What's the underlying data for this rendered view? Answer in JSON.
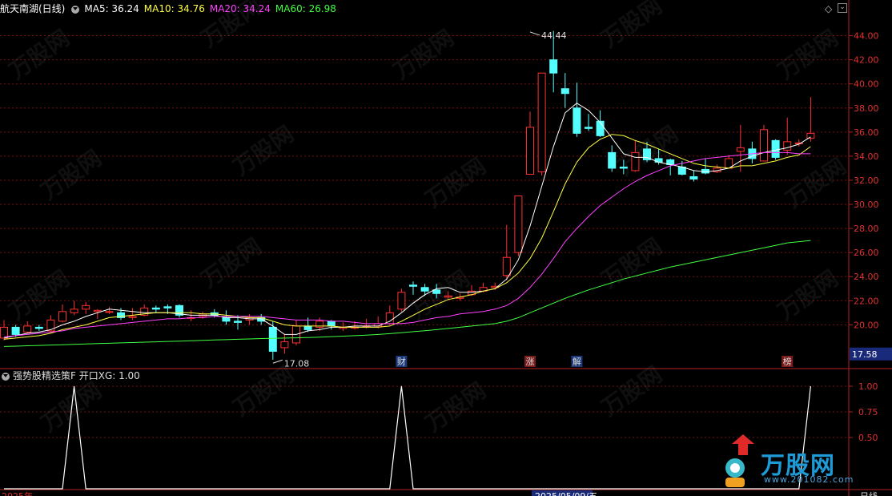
{
  "header": {
    "stock": "航天南湖(日线)",
    "ma": [
      {
        "label": "MA5: 36.24",
        "color": "#ffffff"
      },
      {
        "label": "MA10: 34.76",
        "color": "#ffff40"
      },
      {
        "label": "MA20: 34.24",
        "color": "#ff40ff"
      },
      {
        "label": "MA60: 26.98",
        "color": "#40ff40"
      }
    ]
  },
  "sub_header": {
    "label": "强势股精选策F 开口XG: 1.00"
  },
  "current_price": "17.58",
  "logo": {
    "text": "万股网",
    "url": "www.201082.com"
  },
  "bottom_labels": {
    "left": "2025年",
    "date": "2025/05/09/五",
    "right": "日线"
  },
  "colors": {
    "up": "#ff3030",
    "down": "#54ffff",
    "grid": "#7a1010",
    "ma5": "#ffffff",
    "ma10": "#ffff40",
    "ma20": "#ff40ff",
    "ma60": "#40ff40"
  },
  "chart_data": [
    {
      "type": "candlestick",
      "title": "航天南湖(日线)",
      "ylim": [
        16.5,
        45.5
      ],
      "yticks": [
        20,
        22,
        24,
        26,
        28,
        30,
        32,
        34,
        36,
        38,
        40,
        42,
        44
      ],
      "ytick_labels": [
        "20.00",
        "22.00",
        "24.00",
        "26.00",
        "28.00",
        "30.00",
        "32.00",
        "34.00",
        "36.00",
        "38.00",
        "40.00",
        "42.00",
        "44.00"
      ],
      "annotations": [
        {
          "text": "44.44",
          "index": 45,
          "value": 44.44
        },
        {
          "text": "17.08",
          "index": 23,
          "value": 17.08
        }
      ],
      "event_labels": [
        {
          "text": "财",
          "index": 34
        },
        {
          "text": "涨",
          "index": 45
        },
        {
          "text": "解",
          "index": 49
        },
        {
          "text": "榜",
          "index": 67
        }
      ],
      "candles": [
        [
          18.9,
          19.8,
          20.4,
          18.7
        ],
        [
          19.8,
          19.2,
          20.0,
          19.0
        ],
        [
          19.4,
          19.9,
          20.3,
          19.3
        ],
        [
          19.8,
          19.7,
          20.0,
          19.5
        ],
        [
          19.5,
          20.4,
          20.8,
          19.4
        ],
        [
          20.3,
          21.1,
          21.7,
          20.2
        ],
        [
          21.0,
          21.3,
          22.0,
          20.8
        ],
        [
          21.3,
          21.6,
          21.9,
          20.9
        ],
        [
          21.1,
          21.2,
          21.3,
          20.5
        ],
        [
          21.1,
          21.1,
          21.5,
          20.9
        ],
        [
          21.0,
          20.6,
          21.4,
          20.4
        ],
        [
          20.6,
          20.7,
          21.4,
          20.4
        ],
        [
          20.8,
          21.4,
          21.7,
          20.7
        ],
        [
          21.4,
          21.3,
          21.6,
          21.0
        ],
        [
          21.5,
          21.4,
          21.7,
          20.9
        ],
        [
          21.6,
          20.8,
          21.7,
          20.6
        ],
        [
          20.6,
          20.6,
          21.2,
          20.3
        ],
        [
          20.7,
          20.9,
          21.1,
          20.5
        ],
        [
          21.0,
          20.8,
          21.3,
          20.6
        ],
        [
          20.6,
          20.3,
          21.2,
          20.0
        ],
        [
          20.3,
          20.2,
          20.8,
          19.6
        ],
        [
          20.4,
          20.6,
          20.9,
          20.0
        ],
        [
          20.6,
          20.3,
          20.9,
          20.0
        ],
        [
          19.8,
          17.8,
          20.3,
          17.1
        ],
        [
          18.1,
          18.6,
          19.2,
          17.6
        ],
        [
          18.5,
          19.9,
          20.4,
          18.3
        ],
        [
          19.9,
          19.6,
          20.6,
          19.4
        ],
        [
          19.8,
          20.3,
          20.6,
          19.5
        ],
        [
          20.3,
          19.9,
          20.4,
          19.6
        ],
        [
          19.7,
          19.8,
          20.2,
          19.5
        ],
        [
          19.8,
          19.8,
          20.3,
          19.6
        ],
        [
          19.9,
          19.9,
          20.5,
          19.7
        ],
        [
          19.9,
          20.1,
          20.7,
          19.7
        ],
        [
          20.1,
          21.0,
          21.6,
          20.0
        ],
        [
          21.3,
          22.7,
          23.0,
          21.1
        ],
        [
          23.3,
          23.2,
          23.6,
          22.5
        ],
        [
          23.1,
          22.8,
          23.4,
          22.4
        ],
        [
          22.9,
          22.6,
          23.4,
          22.2
        ],
        [
          22.3,
          22.4,
          22.8,
          22.1
        ],
        [
          22.2,
          22.3,
          22.6,
          22.0
        ],
        [
          22.5,
          22.8,
          23.3,
          22.4
        ],
        [
          22.8,
          23.1,
          23.5,
          22.7
        ],
        [
          23.1,
          23.2,
          23.5,
          22.9
        ],
        [
          24.1,
          25.6,
          28.3,
          23.7
        ],
        [
          26.0,
          30.7,
          30.7,
          25.7
        ],
        [
          32.5,
          36.4,
          37.7,
          32.5
        ],
        [
          32.7,
          40.9,
          40.9,
          32.4
        ],
        [
          42.0,
          40.9,
          44.4,
          39.3
        ],
        [
          39.6,
          39.2,
          40.9,
          38.0
        ],
        [
          38.0,
          35.9,
          40.1,
          35.6
        ],
        [
          36.4,
          36.3,
          37.5,
          36.1
        ],
        [
          36.9,
          35.7,
          37.8,
          35.6
        ],
        [
          34.3,
          33.0,
          34.9,
          32.7
        ],
        [
          33.1,
          33.0,
          33.7,
          32.5
        ],
        [
          32.8,
          34.3,
          35.3,
          32.7
        ],
        [
          34.6,
          33.7,
          35.2,
          33.5
        ],
        [
          33.8,
          33.5,
          34.6,
          33.3
        ],
        [
          33.7,
          33.3,
          33.8,
          32.4
        ],
        [
          33.1,
          32.5,
          33.6,
          32.4
        ],
        [
          32.3,
          32.1,
          32.8,
          31.9
        ],
        [
          32.9,
          32.6,
          33.8,
          32.5
        ],
        [
          32.7,
          33.0,
          33.3,
          32.6
        ],
        [
          33.0,
          33.8,
          34.1,
          33.0
        ],
        [
          34.4,
          34.7,
          36.6,
          32.7
        ],
        [
          34.6,
          33.8,
          35.2,
          33.4
        ],
        [
          33.6,
          36.2,
          36.6,
          33.6
        ],
        [
          35.3,
          33.9,
          35.4,
          33.7
        ],
        [
          34.5,
          35.2,
          37.2,
          34.1
        ],
        [
          35.1,
          35.1,
          35.4,
          34.8
        ],
        [
          35.5,
          35.9,
          38.9,
          35.2
        ]
      ],
      "series": [
        {
          "name": "MA5",
          "values": [
            18.9,
            19.1,
            19.3,
            19.4,
            19.6,
            20.0,
            20.3,
            20.7,
            21.0,
            21.3,
            21.2,
            21.1,
            21.0,
            21.0,
            21.0,
            20.9,
            20.8,
            20.8,
            20.8,
            20.6,
            20.6,
            20.5,
            20.5,
            19.9,
            19.2,
            19.2,
            19.5,
            19.6,
            19.8,
            19.8,
            19.9,
            19.9,
            19.9,
            20.3,
            21.0,
            21.8,
            22.5,
            23.0,
            23.1,
            22.7,
            22.7,
            22.8,
            23.0,
            23.8,
            25.4,
            28.2,
            31.5,
            34.8,
            37.6,
            38.4,
            37.8,
            36.8,
            35.5,
            34.2,
            33.9,
            33.9,
            33.5,
            33.3,
            33.1,
            32.8,
            32.7,
            32.8,
            33.0,
            33.6,
            34.0,
            34.3,
            34.5,
            34.7,
            35.0,
            35.6
          ]
        },
        {
          "name": "MA10",
          "values": [
            18.8,
            18.9,
            19.0,
            19.1,
            19.3,
            19.6,
            19.8,
            20.0,
            20.3,
            20.6,
            20.7,
            20.8,
            20.9,
            21.0,
            21.0,
            21.0,
            21.0,
            20.9,
            20.9,
            20.8,
            20.7,
            20.6,
            20.6,
            20.3,
            20.0,
            19.9,
            19.9,
            19.9,
            19.9,
            19.8,
            19.8,
            19.8,
            19.8,
            19.9,
            20.3,
            20.8,
            21.3,
            21.7,
            22.1,
            22.3,
            22.5,
            22.8,
            23.0,
            23.5,
            24.3,
            25.5,
            27.2,
            29.4,
            31.7,
            33.5,
            34.7,
            35.4,
            35.8,
            35.7,
            35.3,
            35.0,
            34.6,
            34.2,
            33.8,
            33.4,
            33.2,
            33.1,
            33.0,
            33.2,
            33.2,
            33.4,
            33.6,
            33.9,
            34.1,
            34.8
          ]
        },
        {
          "name": "MA20",
          "values": [
            19.0,
            19.1,
            19.2,
            19.3,
            19.4,
            19.5,
            19.7,
            19.8,
            19.9,
            20.0,
            20.1,
            20.2,
            20.3,
            20.4,
            20.5,
            20.5,
            20.6,
            20.6,
            20.7,
            20.7,
            20.7,
            20.7,
            20.7,
            20.6,
            20.5,
            20.4,
            20.4,
            20.4,
            20.3,
            20.3,
            20.2,
            20.1,
            20.1,
            20.1,
            20.1,
            20.2,
            20.4,
            20.6,
            20.7,
            20.9,
            21.0,
            21.1,
            21.3,
            21.6,
            22.2,
            23.1,
            24.2,
            25.5,
            26.9,
            28.0,
            29.0,
            29.9,
            30.6,
            31.3,
            31.9,
            32.4,
            32.8,
            33.2,
            33.4,
            33.6,
            33.8,
            33.9,
            34.0,
            34.1,
            34.2,
            34.3,
            34.3,
            34.3,
            34.2,
            34.2
          ]
        },
        {
          "name": "MA60",
          "values": [
            18.2,
            18.23,
            18.26,
            18.29,
            18.32,
            18.35,
            18.38,
            18.41,
            18.44,
            18.47,
            18.5,
            18.53,
            18.56,
            18.59,
            18.62,
            18.65,
            18.68,
            18.71,
            18.74,
            18.77,
            18.8,
            18.83,
            18.86,
            18.88,
            18.9,
            18.92,
            18.95,
            18.98,
            19.02,
            19.06,
            19.1,
            19.15,
            19.2,
            19.27,
            19.35,
            19.43,
            19.51,
            19.6,
            19.7,
            19.8,
            19.9,
            20.0,
            20.1,
            20.3,
            20.6,
            21.0,
            21.4,
            21.8,
            22.2,
            22.55,
            22.9,
            23.2,
            23.5,
            23.8,
            24.05,
            24.3,
            24.55,
            24.8,
            25.0,
            25.2,
            25.4,
            25.6,
            25.8,
            26.0,
            26.2,
            26.4,
            26.6,
            26.8,
            26.9,
            27.0
          ]
        }
      ]
    },
    {
      "type": "line",
      "title": "强势股精选策F 开口XG",
      "ylim": [
        0,
        1.0
      ],
      "yticks": [
        0.5,
        0.75,
        1.0
      ],
      "ytick_labels": [
        "0.50",
        "0.75",
        "1.00"
      ],
      "series": [
        {
          "name": "XG",
          "values": [
            0,
            0,
            0,
            0,
            0,
            0,
            1,
            0,
            0,
            0,
            0,
            0,
            0,
            0,
            0,
            0,
            0,
            0,
            0,
            0,
            0,
            0,
            0,
            0,
            0,
            0,
            0,
            0,
            0,
            0,
            0,
            0,
            0,
            0,
            1,
            0,
            0,
            0,
            0,
            0,
            0,
            0,
            0,
            0,
            0,
            0,
            0,
            0,
            0,
            0,
            0,
            0,
            0,
            0,
            0,
            0,
            0,
            0,
            0,
            0,
            0,
            0,
            0,
            0,
            0,
            0,
            0,
            0,
            0,
            1
          ]
        }
      ]
    }
  ]
}
